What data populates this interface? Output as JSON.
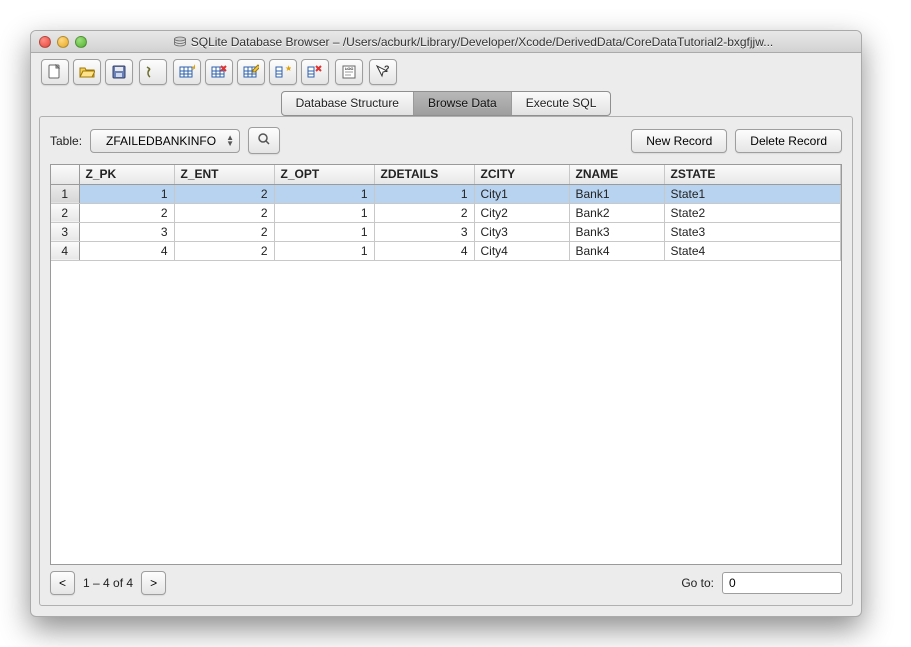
{
  "title": "SQLite Database Browser – /Users/acburk/Library/Developer/Xcode/DerivedData/CoreDataTutorial2-bxgfjjw...",
  "tabs": [
    "Database Structure",
    "Browse Data",
    "Execute SQL"
  ],
  "active_tab": 1,
  "table_label": "Table:",
  "table_selected": "ZFAILEDBANKINFO",
  "new_record": "New Record",
  "delete_record": "Delete Record",
  "columns": [
    "Z_PK",
    "Z_ENT",
    "Z_OPT",
    "ZDETAILS",
    "ZCITY",
    "ZNAME",
    "ZSTATE"
  ],
  "rows": [
    {
      "n": "1",
      "Z_PK": "1",
      "Z_ENT": "2",
      "Z_OPT": "1",
      "ZDETAILS": "1",
      "ZCITY": "City1",
      "ZNAME": "Bank1",
      "ZSTATE": "State1",
      "selected": true
    },
    {
      "n": "2",
      "Z_PK": "2",
      "Z_ENT": "2",
      "Z_OPT": "1",
      "ZDETAILS": "2",
      "ZCITY": "City2",
      "ZNAME": "Bank2",
      "ZSTATE": "State2"
    },
    {
      "n": "3",
      "Z_PK": "3",
      "Z_ENT": "2",
      "Z_OPT": "1",
      "ZDETAILS": "3",
      "ZCITY": "City3",
      "ZNAME": "Bank3",
      "ZSTATE": "State3"
    },
    {
      "n": "4",
      "Z_PK": "4",
      "Z_ENT": "2",
      "Z_OPT": "1",
      "ZDETAILS": "4",
      "ZCITY": "City4",
      "ZNAME": "Bank4",
      "ZSTATE": "State4"
    }
  ],
  "pager": {
    "prev": "<",
    "next": ">",
    "status": "1 – 4 of 4"
  },
  "goto_label": "Go to:",
  "goto_value": "0"
}
